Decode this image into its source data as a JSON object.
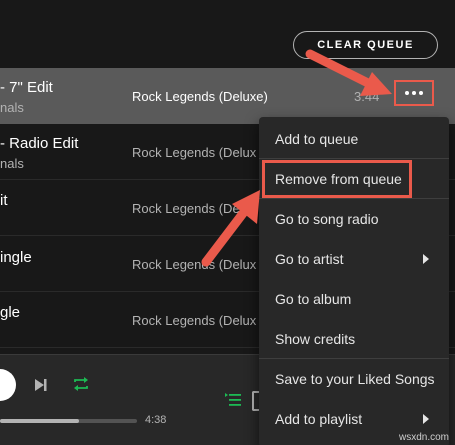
{
  "header": {
    "clear_queue_label": "CLEAR QUEUE"
  },
  "queue": {
    "rows": [
      {
        "title": "- 7\" Edit",
        "artist": "nals",
        "album": "Rock Legends (Deluxe)",
        "duration": "3:44"
      },
      {
        "title": "- Radio Edit",
        "artist": "nals",
        "album": "Rock Legends (Delux"
      },
      {
        "title": "it",
        "album": "Rock Legends (Delux"
      },
      {
        "title": "ingle",
        "album": "Rock Legends (Delux"
      },
      {
        "title": "gle",
        "album": "Rock Legends (Delux"
      }
    ]
  },
  "context_menu": {
    "items": [
      {
        "label": "Add to queue"
      },
      {
        "label": "Remove from queue",
        "highlighted": true
      },
      {
        "label": "Go to song radio"
      },
      {
        "label": "Go to artist",
        "submenu": true
      },
      {
        "label": "Go to album"
      },
      {
        "label": "Show credits"
      },
      {
        "label": "Save to your Liked Songs"
      },
      {
        "label": "Add to playlist",
        "submenu": true
      }
    ]
  },
  "player": {
    "total_time": "4:38",
    "progress_fraction": 0.58
  },
  "watermark": "wsxdn.com",
  "colors": {
    "annotation": "#ea5a4b",
    "accent_green": "#1db954",
    "menu_bg": "#282828",
    "active_row_bg": "#5a5a5a"
  }
}
